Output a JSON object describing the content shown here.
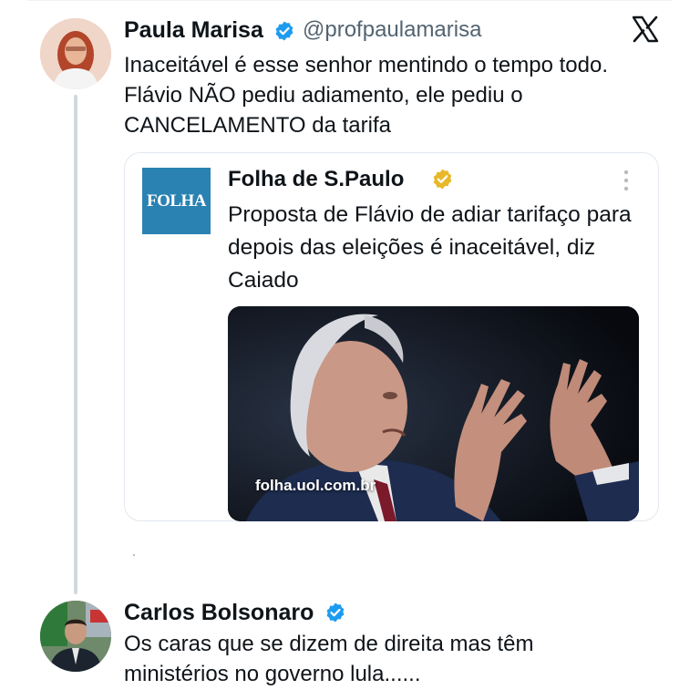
{
  "tweet": {
    "author_name": "Paula Marisa",
    "author_handle": "@profpaulamarisa",
    "text": "Inaceitável é esse senhor mentindo o tempo todo.\nFlávio NÃO pediu adiamento, ele pediu o\nCANCELAMENTO da tarifa",
    "platform_icon": "x-logo-icon"
  },
  "quoted": {
    "logo_text": "FOLHA",
    "author_name": "Folha de S.Paulo",
    "text": "Proposta de Flávio de adiar tarifaço para depois das eleições é inaceitável, diz Caiado",
    "image_domain": "folha.uol.com.br",
    "brand_color": "#2a82b2",
    "badge_color": "#e8b829"
  },
  "reply": {
    "author_name": "Carlos Bolsonaro",
    "text": "Os caras que se dizem de direita mas têm\nministérios no governo lula......"
  },
  "colors": {
    "verified_blue": "#1d9bf0",
    "thread_line": "#cfd9de",
    "text": "#0f1419",
    "secondary": "#536471"
  }
}
